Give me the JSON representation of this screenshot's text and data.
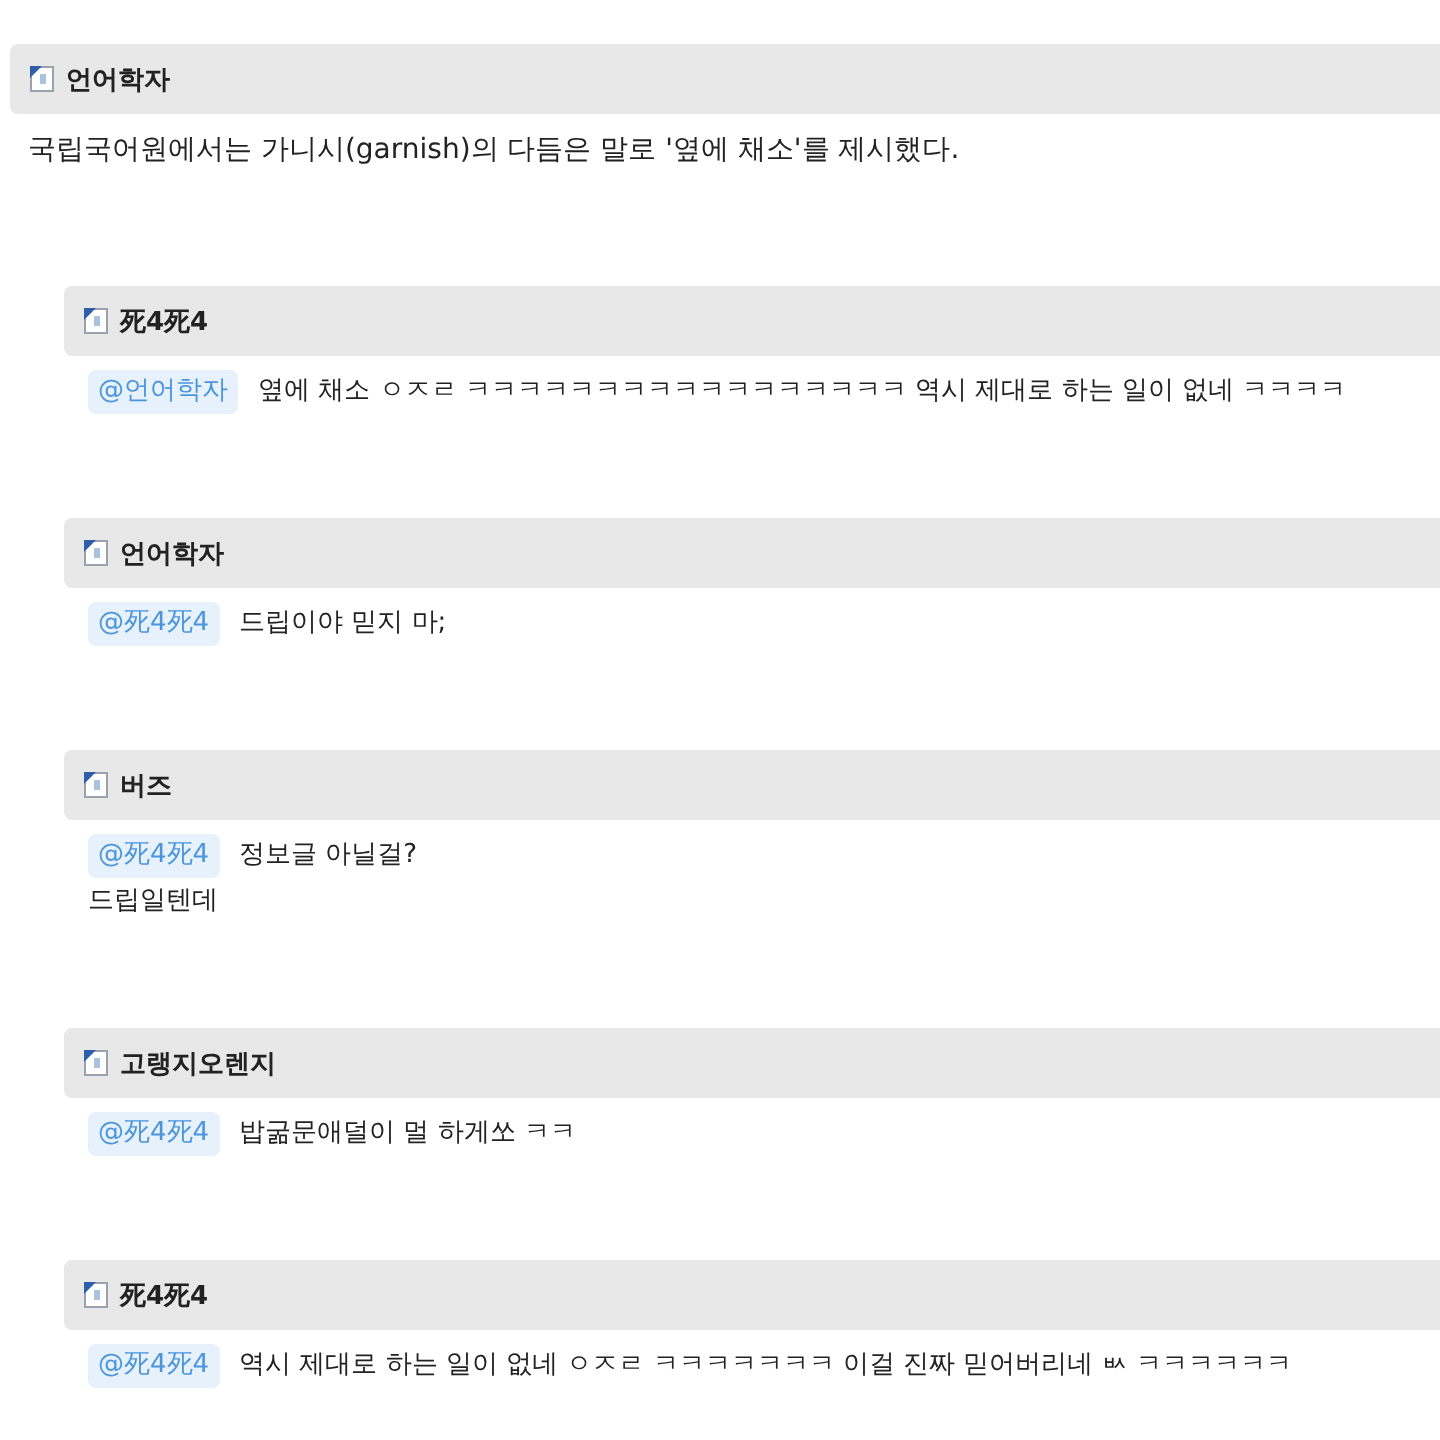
{
  "post": {
    "author": "언어학자",
    "body": "국립국어원에서는 가니시(garnish)의 다듬은 말로 '옆에 채소'를 제시했다."
  },
  "comments": [
    {
      "author": "死4死4",
      "mention": "@언어학자",
      "lines": [
        "옆에 채소 ㅇㅈㄹ ㅋㅋㅋㅋㅋㅋㅋㅋㅋㅋㅋㅋㅋㅋㅋㅋㅋ 역시 제대로 하는 일이 없네 ㅋㅋㅋㅋ"
      ]
    },
    {
      "author": "언어학자",
      "mention": "@死4死4",
      "lines": [
        "드립이야 믿지 마;"
      ]
    },
    {
      "author": "버즈",
      "mention": "@死4死4",
      "lines": [
        "정보글 아닐걸?",
        "드립일텐데"
      ]
    },
    {
      "author": "고랭지오렌지",
      "mention": "@死4死4",
      "lines": [
        "밥굶문애덜이 멀 하게쏘 ㅋㅋ"
      ]
    },
    {
      "author": "死4死4",
      "mention": "@死4死4",
      "lines": [
        "역시 제대로 하는 일이 없네 ㅇㅈㄹ ㅋㅋㅋㅋㅋㅋㅋ 이걸 진짜 믿어버리네 ㅄ ㅋㅋㅋㅋㅋㅋ"
      ]
    }
  ]
}
